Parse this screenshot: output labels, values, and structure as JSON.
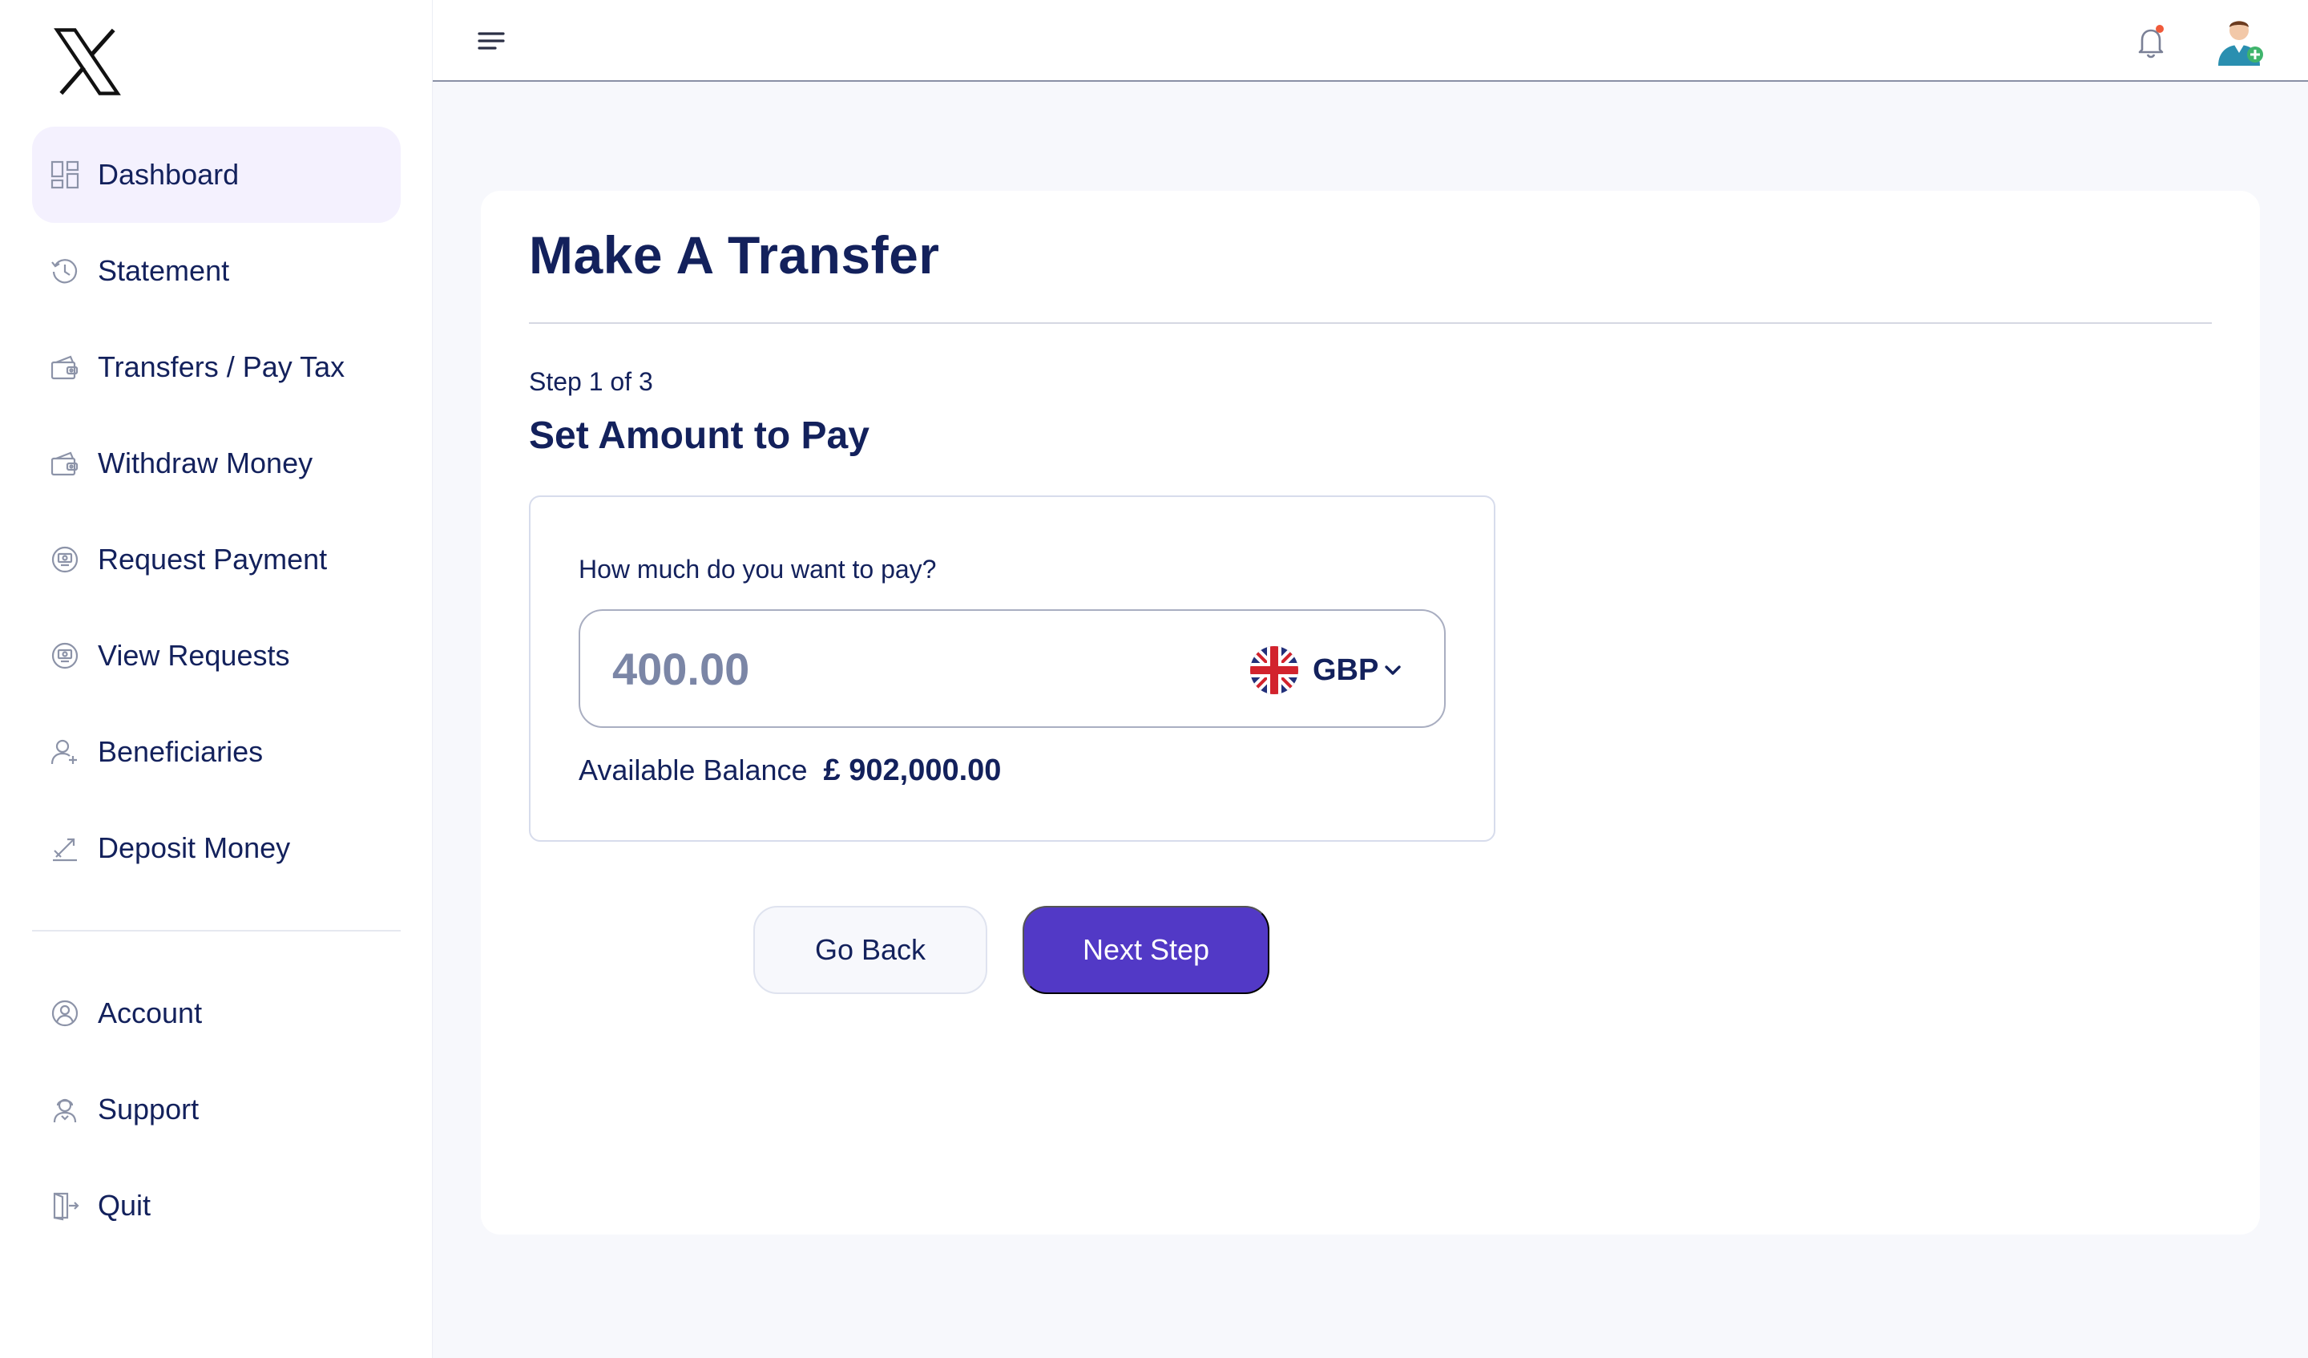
{
  "sidebar": {
    "logo_icon": "x-logo-icon",
    "items": [
      {
        "label": "Dashboard",
        "icon": "dashboard-icon",
        "active": true
      },
      {
        "label": "Statement",
        "icon": "history-icon"
      },
      {
        "label": "Transfers / Pay Tax",
        "icon": "wallet-icon"
      },
      {
        "label": "Withdraw Money",
        "icon": "wallet-icon"
      },
      {
        "label": "Request Payment",
        "icon": "money-request-icon"
      },
      {
        "label": "View Requests",
        "icon": "money-request-icon"
      },
      {
        "label": "Beneficiaries",
        "icon": "user-add-icon"
      },
      {
        "label": "Deposit Money",
        "icon": "deposit-icon"
      }
    ],
    "secondary_items": [
      {
        "label": "Account",
        "icon": "user-circle-icon"
      },
      {
        "label": "Support",
        "icon": "support-agent-icon"
      },
      {
        "label": "Quit",
        "icon": "exit-door-icon"
      }
    ]
  },
  "topbar": {
    "menu_icon": "hamburger-icon",
    "notification_icon": "bell-icon",
    "notification_dot_color": "#f05a3a",
    "avatar_icon": "user-avatar-icon"
  },
  "main": {
    "title": "Make A Transfer",
    "step": "Step 1 of 3",
    "section_title": "Set Amount to Pay",
    "amount_question": "How much do you want to pay?",
    "amount_value": "400.00",
    "currency": {
      "code": "GBP",
      "flag_icon": "uk-flag-icon"
    },
    "balance_label": "Available Balance",
    "balance_value": "£ 902,000.00",
    "go_back_label": "Go Back",
    "next_step_label": "Next Step"
  },
  "colors": {
    "primary": "#5239c6",
    "navy_text": "#13215c",
    "active_nav_bg": "#f4f1fe",
    "page_bg": "#f7f8fc"
  }
}
